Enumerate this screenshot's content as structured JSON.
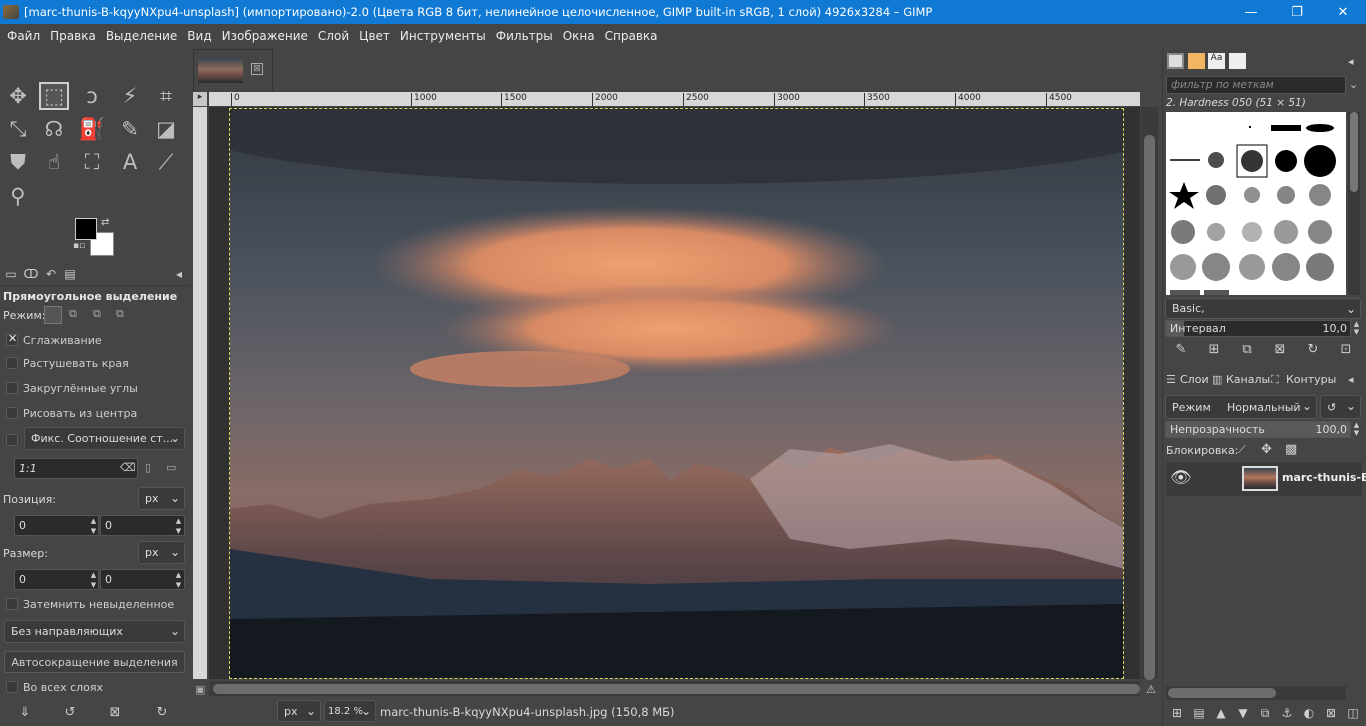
{
  "window": {
    "title": "[marc-thunis-B-kqyyNXpu4-unsplash] (импортировано)-2.0 (Цвета RGB 8 бит, нелинейное целочисленное, GIMP built-in sRGB, 1 слой) 4926x3284 – GIMP",
    "minimize": "—",
    "maximize": "❐",
    "close": "✕"
  },
  "menu": [
    "Файл",
    "Правка",
    "Выделение",
    "Вид",
    "Изображение",
    "Слой",
    "Цвет",
    "Инструменты",
    "Фильтры",
    "Окна",
    "Справка"
  ],
  "toolbox": {
    "tools": [
      {
        "name": "move-tool",
        "glyph": "✥"
      },
      {
        "name": "rect-select-tool",
        "glyph": "⬚",
        "selected": true
      },
      {
        "name": "free-select-tool",
        "glyph": "ↄ"
      },
      {
        "name": "fuzzy-select-tool",
        "glyph": "⚡"
      },
      {
        "name": "crop-tool",
        "glyph": "⌗"
      },
      {
        "name": "unified-transform-tool",
        "glyph": "⤡"
      },
      {
        "name": "warp-tool",
        "glyph": "☊"
      },
      {
        "name": "bucket-fill-tool",
        "glyph": "⛽"
      },
      {
        "name": "paintbrush-tool",
        "glyph": "✎"
      },
      {
        "name": "eraser-tool",
        "glyph": "◪"
      },
      {
        "name": "clone-tool",
        "glyph": "⛊"
      },
      {
        "name": "smudge-tool",
        "glyph": "☝"
      },
      {
        "name": "paths-tool",
        "glyph": "⛶"
      },
      {
        "name": "text-tool",
        "glyph": "A"
      },
      {
        "name": "color-picker-tool",
        "glyph": "⟋"
      },
      {
        "name": "zoom-tool",
        "glyph": "⚲"
      }
    ],
    "fg_color": "#000000",
    "bg_color": "#ffffff"
  },
  "tool_options": {
    "title": "Прямоугольное выделение",
    "mode_label": "Режим:",
    "antialias": {
      "label": "Сглаживание",
      "checked": true
    },
    "feather": {
      "label": "Растушевать края",
      "checked": false
    },
    "rounded": {
      "label": "Закруглённые углы",
      "checked": false
    },
    "from_center": {
      "label": "Рисовать из центра",
      "checked": false
    },
    "fixed": {
      "label": "Фикс. Соотношение ст...",
      "checked": false
    },
    "ratio_value": "1:1",
    "position_label": "Позиция:",
    "size_label": "Размер:",
    "unit": "px",
    "pos_x": "0",
    "pos_y": "0",
    "size_w": "0",
    "size_h": "0",
    "highlight": {
      "label": "Затемнить невыделенное",
      "checked": false
    },
    "guides": "Без направляющих",
    "autoshrink": "Автосокращение выделения",
    "all_layers": {
      "label": "Во всех слоях",
      "checked": false
    }
  },
  "canvas": {
    "ruler_ticks": [
      "0",
      "1000",
      "1500",
      "2000",
      "2500",
      "3000",
      "3500",
      "4000",
      "4500"
    ],
    "image_tab_close": "⊠"
  },
  "status": {
    "unit": "px",
    "zoom": "18.2 %",
    "file": "marc-thunis-B-kqyyNXpu4-unsplash.jpg (150,8 МБ)"
  },
  "brushes": {
    "filter_placeholder": "фильтр по меткам",
    "current": "2. Hardness 050 (51 × 51)",
    "preset": "Basic,",
    "spacing_label": "Интервал",
    "spacing_value": "10,0",
    "spacing": 0.1
  },
  "layers": {
    "tabs": [
      "Слои",
      "Каналы",
      "Контуры"
    ],
    "mode_label": "Режим",
    "mode_value": "Нормальный",
    "opacity_label": "Непрозрачность",
    "opacity_value": "100,0",
    "opacity": 1.0,
    "lock_label": "Блокировка:",
    "items": [
      {
        "name": "marc-thunis-B",
        "visible": true
      }
    ]
  }
}
